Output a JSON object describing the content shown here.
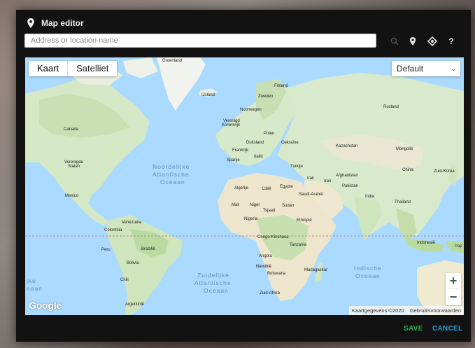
{
  "dialog": {
    "title": "Map editor",
    "search_placeholder": "Address or location name",
    "tools": {
      "search_icon": "search-icon",
      "location_icon": "map-pin-icon",
      "locate_icon": "crosshair-icon",
      "help_label": "?"
    },
    "actions": {
      "save": "SAVE",
      "cancel": "CANCEL"
    }
  },
  "map": {
    "map_types": [
      "Kaart",
      "Satelliet"
    ],
    "active_map_type": "Kaart",
    "style_select": "Default",
    "zoom_in": "+",
    "zoom_out": "−",
    "google_logo": "Google",
    "attribution": [
      "Kaartgegevens ©2020",
      "Gebruiksvoorwaarden"
    ],
    "labels": {
      "groenland": "Groenland",
      "ijsland": "IJsland",
      "finland": "Finland",
      "zweden": "Zweden",
      "noorwegen": "Noorwegen",
      "rusland": "Rusland",
      "vk": "Verenigd Koninkrijk",
      "polen": "Polen",
      "duitsland": "Duitsland",
      "oekraine": "Oekraïne",
      "frankrijk": "Frankrijk",
      "italie": "Italië",
      "spanje": "Spanje",
      "kazachstan": "Kazachstan",
      "mongolie": "Mongolië",
      "china": "China",
      "zuidkorea": "Zuid-Korea",
      "turkije": "Turkije",
      "irak": "Irak",
      "iran": "Iran",
      "afghanistan": "Afghanistan",
      "pakistan": "Pakistan",
      "india": "India",
      "thailand": "Thailand",
      "indonesie": "Indonesië",
      "papua": "Pap",
      "canada": "Canada",
      "vs": "Verenigde Staten",
      "mexico": "Mexico",
      "venezuela": "Venezuela",
      "colombia": "Colombia",
      "peru": "Peru",
      "brazilie": "Brazilië",
      "bolivia": "Bolivia",
      "chili": "Chili",
      "argentinie": "Argentinië",
      "algerije": "Algerije",
      "libie": "Libië",
      "egypte": "Egypte",
      "mali": "Mali",
      "niger": "Niger",
      "tsjaad": "Tsjaad",
      "sudan": "Sudan",
      "saudi": "Saudi-Arabië",
      "nigeria": "Nigeria",
      "ethiopie": "Ethiopië",
      "congo": "Congo-Kinshasa",
      "tanzania": "Tanzania",
      "angola": "Angola",
      "namibie": "Namibië",
      "botswana": "Botswana",
      "madagaskar": "Madagaskar",
      "zuidafrika": "Zuid-Afrika"
    },
    "oceans": {
      "n_atl_1": "Noordelijke",
      "n_atl_2": "Atlantische",
      "n_atl_3": "Oceaan",
      "s_atl_1": "Zuidelijke",
      "s_atl_2": "Atlantische",
      "s_atl_3": "Oceaan",
      "ind_1": "Indische",
      "ind_2": "Oceaan",
      "pac_1": "jke",
      "pac_2": "eaan"
    }
  }
}
